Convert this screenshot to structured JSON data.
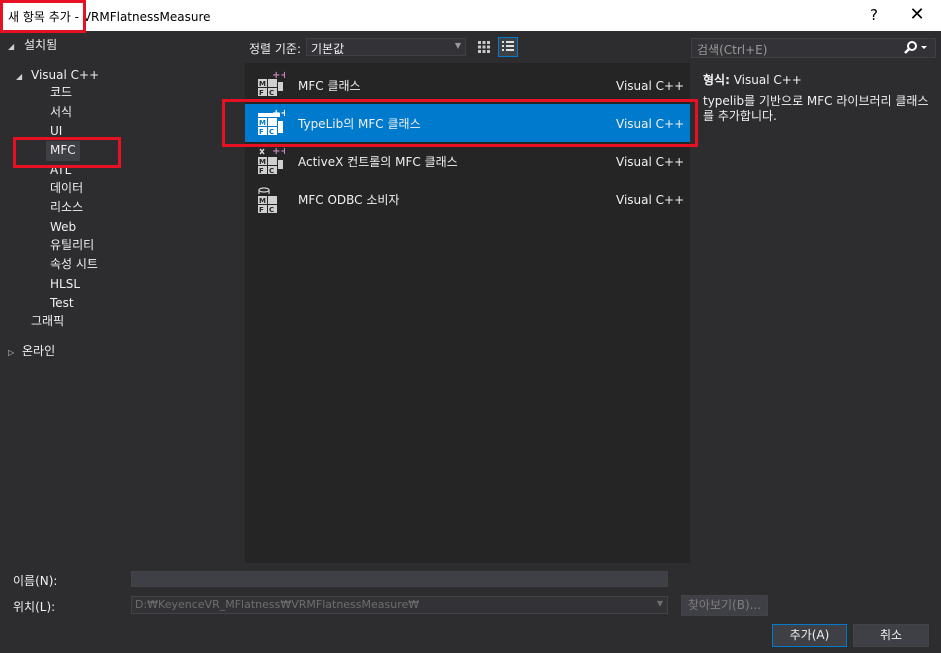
{
  "window": {
    "title_prefix": "새 항목 추가",
    "title_sep": " - ",
    "project": "VRMFlatnessMeasure",
    "help_label": "?",
    "close_label": "✕"
  },
  "tree": {
    "installed": "설치됨",
    "visual_cpp": "Visual C++",
    "children": [
      "코드",
      "서식",
      "UI",
      "MFC",
      "ATL",
      "데이터",
      "리소스",
      "Web",
      "유틸리티",
      "속성 시트",
      "HLSL",
      "Test"
    ],
    "graphics": "그래픽",
    "online": "온라인"
  },
  "toolbar": {
    "sort_label": "정렬 기준:",
    "sort_value": "기본값"
  },
  "items": [
    {
      "name": "MFC 클래스",
      "lang": "Visual C++",
      "icon": "mfc-class-icon"
    },
    {
      "name": "TypeLib의 MFC 클래스",
      "lang": "Visual C++",
      "icon": "typelib-mfc-class-icon",
      "selected": true
    },
    {
      "name": "ActiveX 컨트롤의 MFC 클래스",
      "lang": "Visual C++",
      "icon": "activex-mfc-class-icon"
    },
    {
      "name": "MFC ODBC 소비자",
      "lang": "Visual C++",
      "icon": "mfc-odbc-consumer-icon"
    }
  ],
  "search": {
    "placeholder": "검색(Ctrl+E)"
  },
  "info": {
    "type_label": "형식:",
    "type_value": "Visual C++",
    "description": "typelib를 기반으로 MFC 라이브러리 클래스를 추가합니다."
  },
  "form": {
    "name_label": "이름(N):",
    "name_value": "",
    "location_label": "위치(L):",
    "location_value": "D:₩KeyenceVR_MFlatness₩VRMFlatnessMeasure₩",
    "browse_label": "찾아보기(B)...",
    "add_label": "추가(A)",
    "cancel_label": "취소"
  },
  "colors": {
    "background": "#2d2d30",
    "panel": "#252526",
    "accent": "#007acc",
    "highlight": "#e81123"
  }
}
